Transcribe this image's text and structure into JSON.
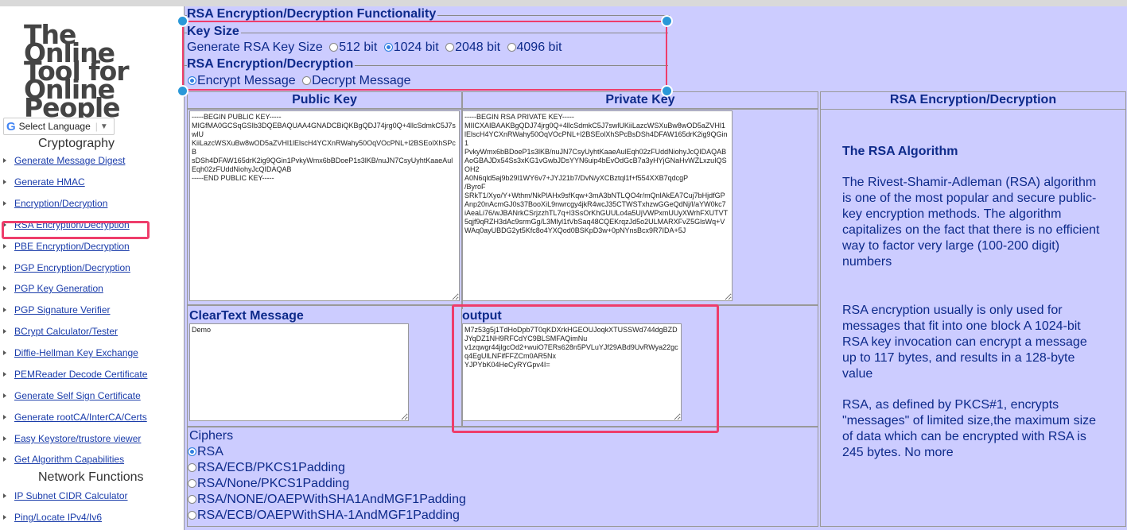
{
  "logo": "The Online Tool for Online People",
  "language_select": "Select Language",
  "sidebar": {
    "section_crypto": "Cryptography",
    "crypto_items": [
      "Generate Message Digest",
      "Generate HMAC",
      "Encryption/Decryption",
      "RSA Encryption/Decryption",
      "PBE Encryption/Decryption",
      "PGP Encryption/Decryption",
      "PGP Key Generation",
      "PGP Signature Verifier",
      "BCrypt Calculator/Tester",
      "Diffie-Hellman Key Exchange",
      "PEMReader Decode Certificate",
      "Generate Self Sign Certificate",
      "Generate rootCA/InterCA/Certs",
      "Easy Keystore/trustore viewer",
      "Get Algorithm Capabilities"
    ],
    "section_network": "Network Functions",
    "network_items": [
      "IP Subnet CIDR Calculator",
      "Ping/Locate IPv4/Iv6"
    ],
    "active_item": "RSA Encryption/Decryption"
  },
  "main": {
    "title": "RSA Encryption/Decryption Functionality",
    "key_size_legend": "Key Size",
    "key_size_label": "Generate RSA Key Size",
    "key_sizes": [
      "512 bit",
      "1024 bit",
      "2048 bit",
      "4096 bit"
    ],
    "key_size_selected": "1024 bit",
    "mode_legend": "RSA Encryption/Decryption",
    "modes": [
      "Encrypt Message",
      "Decrypt Message"
    ],
    "mode_selected": "Encrypt Message",
    "public_key_header": "Public Key",
    "private_key_header": "Private Key",
    "info_header": "RSA Encryption/Decryption",
    "public_key_value": "-----BEGIN PUBLIC KEY-----\nMIGfMA0GCSqGSIb3DQEBAQUAA4GNADCBiQKBgQDJ74jrg0Q+4llcSdmkC5J7swlU\nKiiLazcWSXuBw8wOD5aZVHl1lElscH4YCXnRWahy50OqVOcPNL+l2BSEolXhSPcB\nsDSh4DFAW165drK2ig9QGin1PvkyWmx6bBDoeP1s3lKB/nuJN7CsyUyhtKaaeAul\nEqh02zFUddNiohyJcQIDAQAB\n-----END PUBLIC KEY-----",
    "private_key_value": "-----BEGIN RSA PRIVATE KEY-----\nMIICXAIBAAKBgQDJ74jrg0Q+4llcSdmkC5J7swlUKiiLazcWSXuBw8wOD5aZVHl1\nlElscH4YCXnRWahy50OqVOcPNL+l2BSEolXhSPcBsDSh4DFAW165drK2ig9QGin1\nPvkyWmx6bBDoeP1s3lKB/nuJN7CsyUyhtKaaeAulEqh02zFUddNiohyJcQIDAQAB\nAoGBAJDx54Ss3xKG1vGwbJDsYYN6uip4bEvOdGcB7a3yHYjGNaHvWZLxzuIQSOH2\nA0N6qld5aj9b29l1WY6v7+JYJ21b7/DvN/yXCBztql1f+f554XXB7qdcgP\n/ByroF\nSRkT1/Xyo/Y+Wthm/NkPlAHx9sfKqw+3mA3bNTLQO4r/mQnlAkEA7Cuj7bHjdfGP\nAnp20nAcmGJ0s37BooXiL9nwrcgy4jkR4wcJ35CTWSTxhzwGGeQdNj/l/aYW0kc7\niAeaLi76/wJBANrkCSrjzzhTL7q+l3SsOrKhGUULo4a5UjVWPxmUUyXWrhFXUTVT\n5qjf9qRZH3dAc9srmGg/L3Mlyl1tVbSaq48CQEKrqzJd5o2ULMARXFvZ5GlsWq+V\nWAq0ayUBDG2yt5Kfc8o4YXQod0BSKpD3w+0pNYnsBcx9R7IDA+5J",
    "cleartext_legend": "ClearText Message",
    "cleartext_value": "Demo",
    "output_legend": "output",
    "output_value": "M7z53g5j1TdHoDpb7T0qKDXrkHGEOUJoqkXTUSSWd744dgBZDJYqDZ1NH9RFCdYC9BLSMFAQimNu\nv1zqwgr44jlgcOd2+wuiO7ERs628n5PVLuYJf29ABd9UvRWya22gcq4EgUlLNFifFFZCm0AR5Nx\nYJPYbK04HeCyRYGpv4I=",
    "ciphers_legend": "Ciphers",
    "ciphers": [
      "RSA",
      "RSA/ECB/PKCS1Padding",
      "RSA/None/PKCS1Padding",
      "RSA/NONE/OAEPWithSHA1AndMGF1Padding",
      "RSA/ECB/OAEPWithSHA-1AndMGF1Padding"
    ],
    "cipher_selected": "RSA"
  },
  "info": {
    "heading": "The RSA Algorithm",
    "p1": "The Rivest-Shamir-Adleman (RSA) algorithm is one of the most popular and secure public-key encryption methods. The algorithm capitalizes on the fact that there is no efficient way to factor very large (100-200 digit) numbers",
    "p2": "RSA encryption usually is only used for messages that fit into one block A 1024-bit RSA key invocation can encrypt a message up to 117 bytes, and results in a 128-byte value",
    "p3": "RSA, as defined by PKCS#1, encrypts \"messages\" of limited size,the maximum size of data which can be encrypted with RSA is 245 bytes. No more"
  },
  "colors": {
    "highlight": "#ee3d6b",
    "panel": "#ccccff",
    "text": "#0d2a8a",
    "handle": "#2a98d8"
  }
}
